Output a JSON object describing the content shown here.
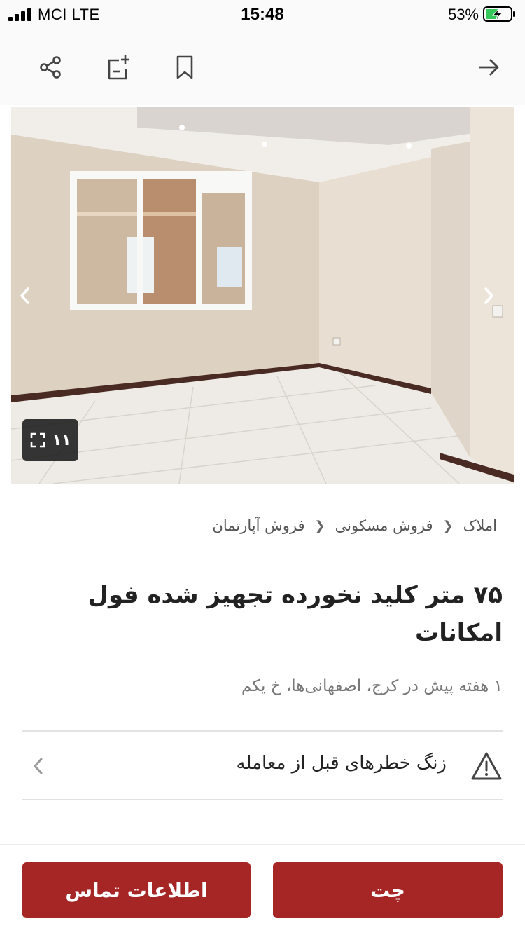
{
  "status_bar": {
    "carrier": "MCI  LTE",
    "time": "15:48",
    "battery": "53%",
    "battery_level": 0.53
  },
  "toolbar": {
    "icons": [
      "share-icon",
      "add-note-icon",
      "bookmark-icon",
      "back-arrow-icon"
    ]
  },
  "gallery": {
    "photo_count": "۱۱",
    "icons": [
      "chevron-left-icon",
      "chevron-right-icon",
      "fullscreen-icon"
    ]
  },
  "breadcrumb": {
    "items": [
      "املاک",
      "فروش مسکونی",
      "فروش آپارتمان"
    ]
  },
  "listing": {
    "title": "۷۵ متر کلید نخورده تجهیز شده فول امکانات",
    "meta": "۱ هفته پیش در کرج، اصفهانی‌ها، خ یکم"
  },
  "warning": {
    "label": "زنگ خطرهای قبل از معامله",
    "icons": [
      "warning-icon",
      "chevron-left-icon"
    ]
  },
  "actions": {
    "chat_label": "چت",
    "contact_label": "اطلاعات تماس"
  },
  "colors": {
    "accent": "#a62626",
    "battery_green": "#34c759"
  }
}
